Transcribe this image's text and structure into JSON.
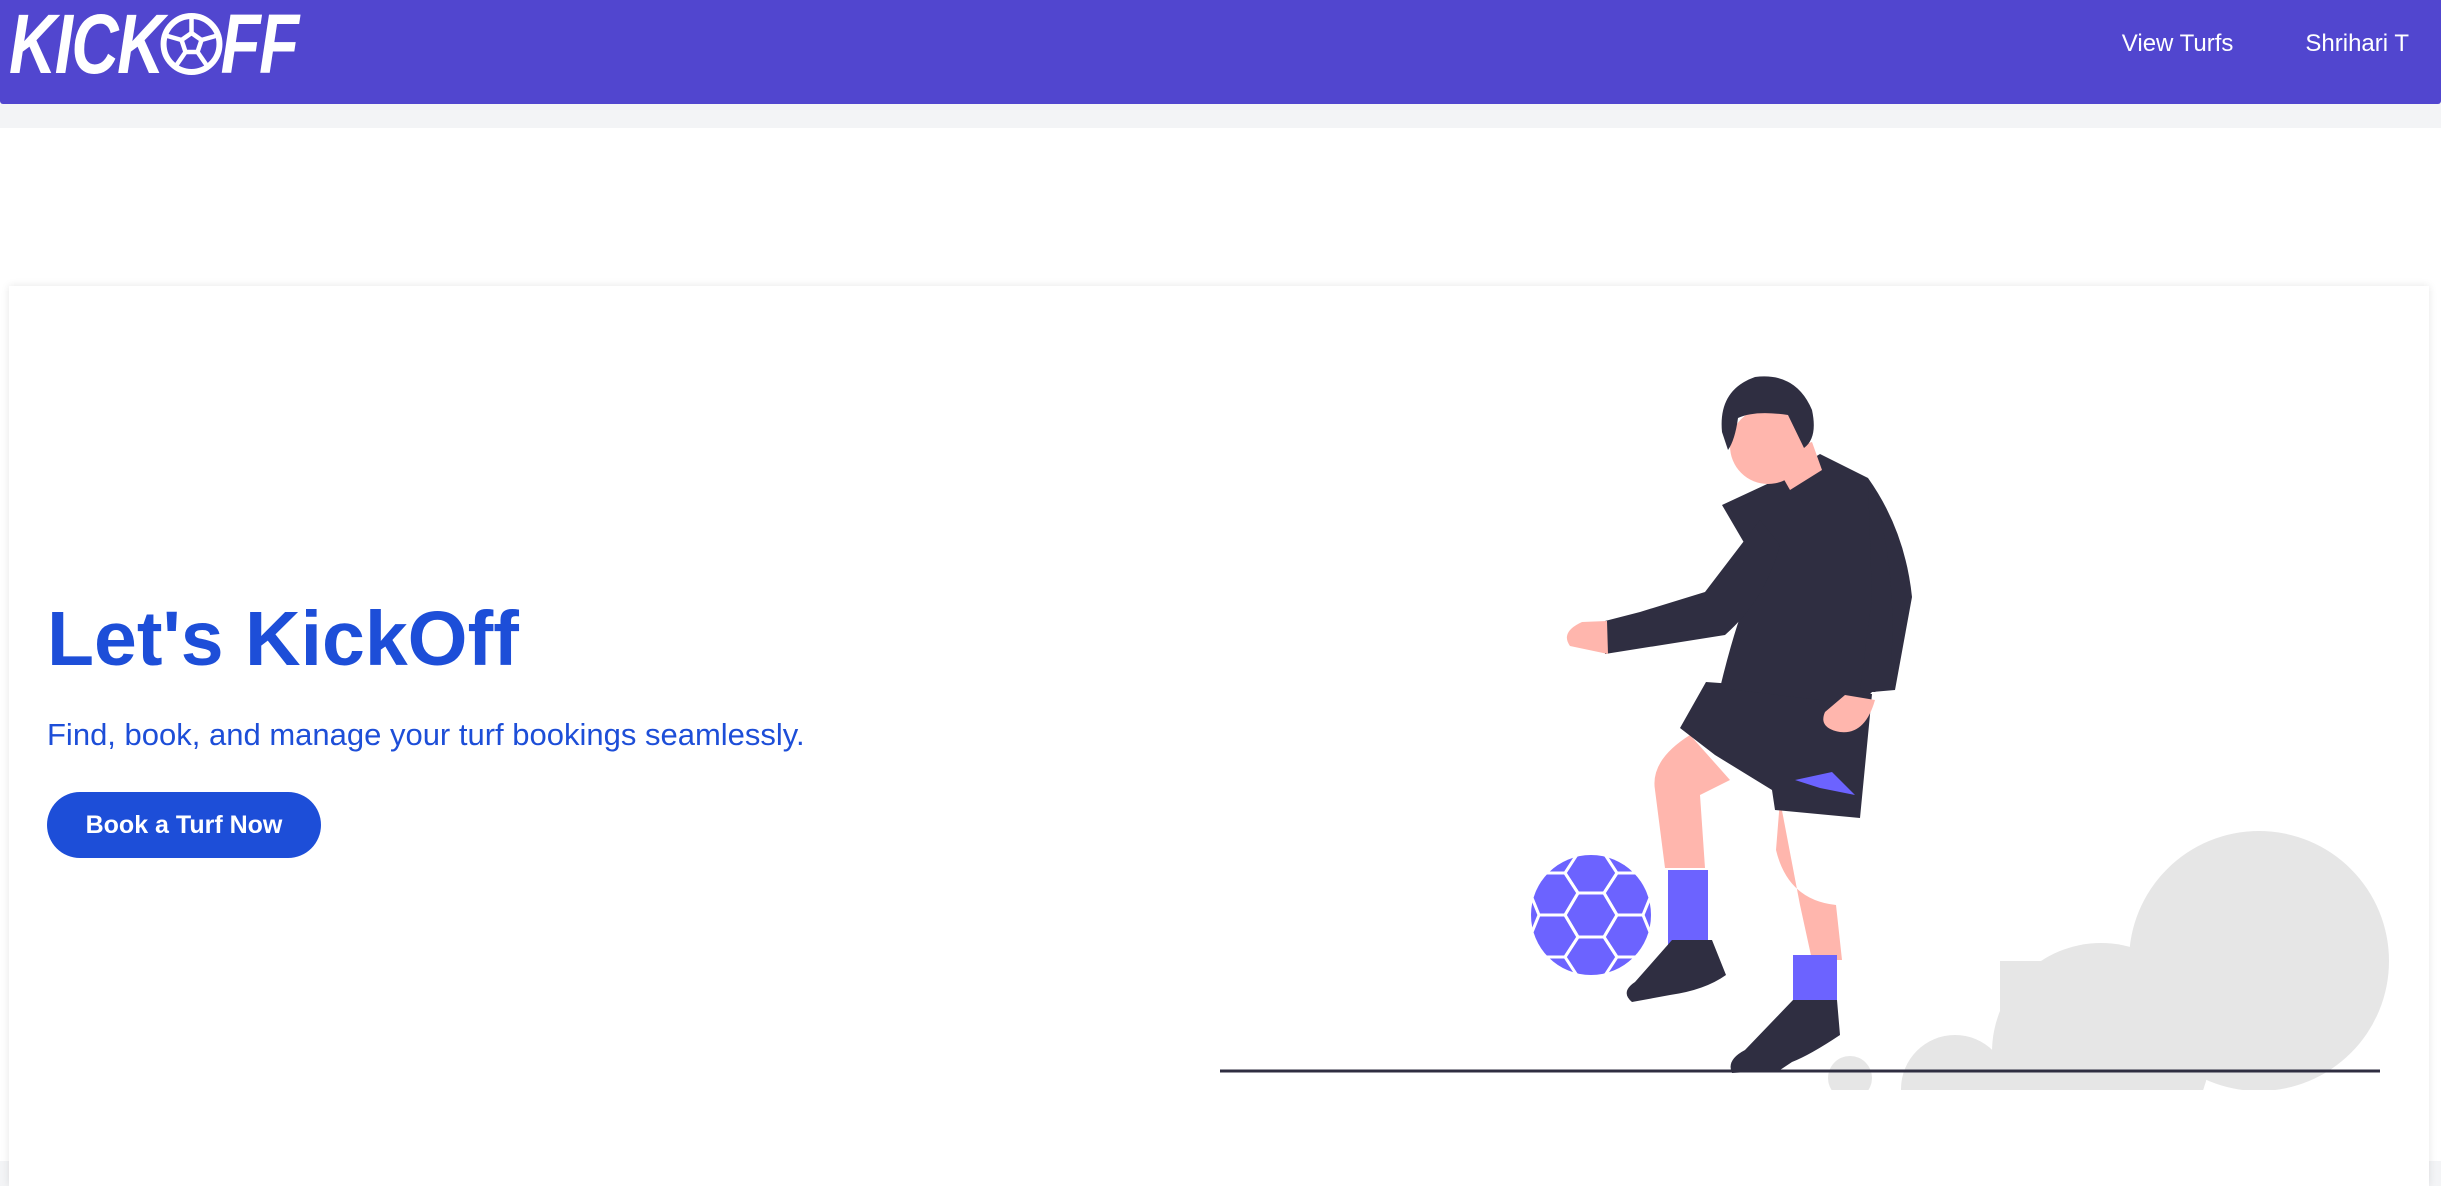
{
  "navbar": {
    "logo_left": "KICK",
    "logo_right": "FF",
    "links": [
      {
        "label": "View Turfs"
      },
      {
        "label": "Shrihari T"
      }
    ],
    "color": "#5146cf"
  },
  "hero": {
    "title": "Let's KickOff",
    "subtitle": "Find, book, and manage your turf bookings seamlessly.",
    "cta_label": "Book a Turf Now",
    "accent_color": "#1d4ed8"
  },
  "icons": {
    "logo_ball": "soccer-ball-icon",
    "illustration": "soccer-player-illustration"
  }
}
